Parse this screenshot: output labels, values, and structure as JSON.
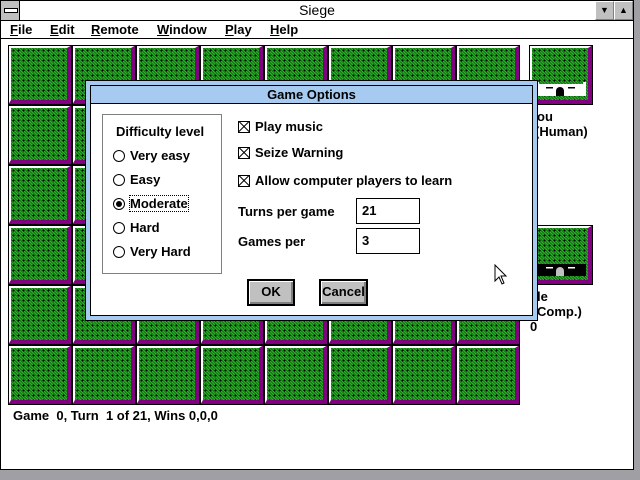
{
  "window": {
    "title": "Siege",
    "minimize": "▼",
    "maximize": "▲"
  },
  "menu": [
    {
      "label": "File",
      "key": "F",
      "rest": "ile"
    },
    {
      "label": "Edit",
      "key": "E",
      "rest": "dit"
    },
    {
      "label": "Remote",
      "key": "R",
      "rest": "emote"
    },
    {
      "label": "Window",
      "key": "W",
      "rest": "indow"
    },
    {
      "label": "Play",
      "key": "P",
      "rest": "lay"
    },
    {
      "label": "Help",
      "key": "H",
      "rest": "elp"
    }
  ],
  "players": [
    {
      "name": "ou",
      "type": "(Human)"
    },
    {
      "name": "le",
      "type": "Comp.)",
      "score": "0"
    }
  ],
  "status": "Game  0, Turn  1 of 21, Wins 0,0,0",
  "dialog": {
    "title": "Game Options",
    "difficulty_label": "Difficulty level",
    "difficulty": [
      {
        "label": "Very easy",
        "checked": false
      },
      {
        "label": "Easy",
        "checked": false
      },
      {
        "label": "Moderate",
        "checked": true
      },
      {
        "label": "Hard",
        "checked": false
      },
      {
        "label": "Very Hard",
        "checked": false
      }
    ],
    "options": [
      {
        "label": "Play music",
        "checked": true
      },
      {
        "label": "Seize Warning",
        "checked": true
      },
      {
        "label": "Allow computer players to learn",
        "checked": true
      }
    ],
    "turns_label": "Turns per game",
    "turns_value": "21",
    "games_label": "Games per",
    "games_value": "3",
    "ok": "OK",
    "cancel": "Cancel"
  }
}
